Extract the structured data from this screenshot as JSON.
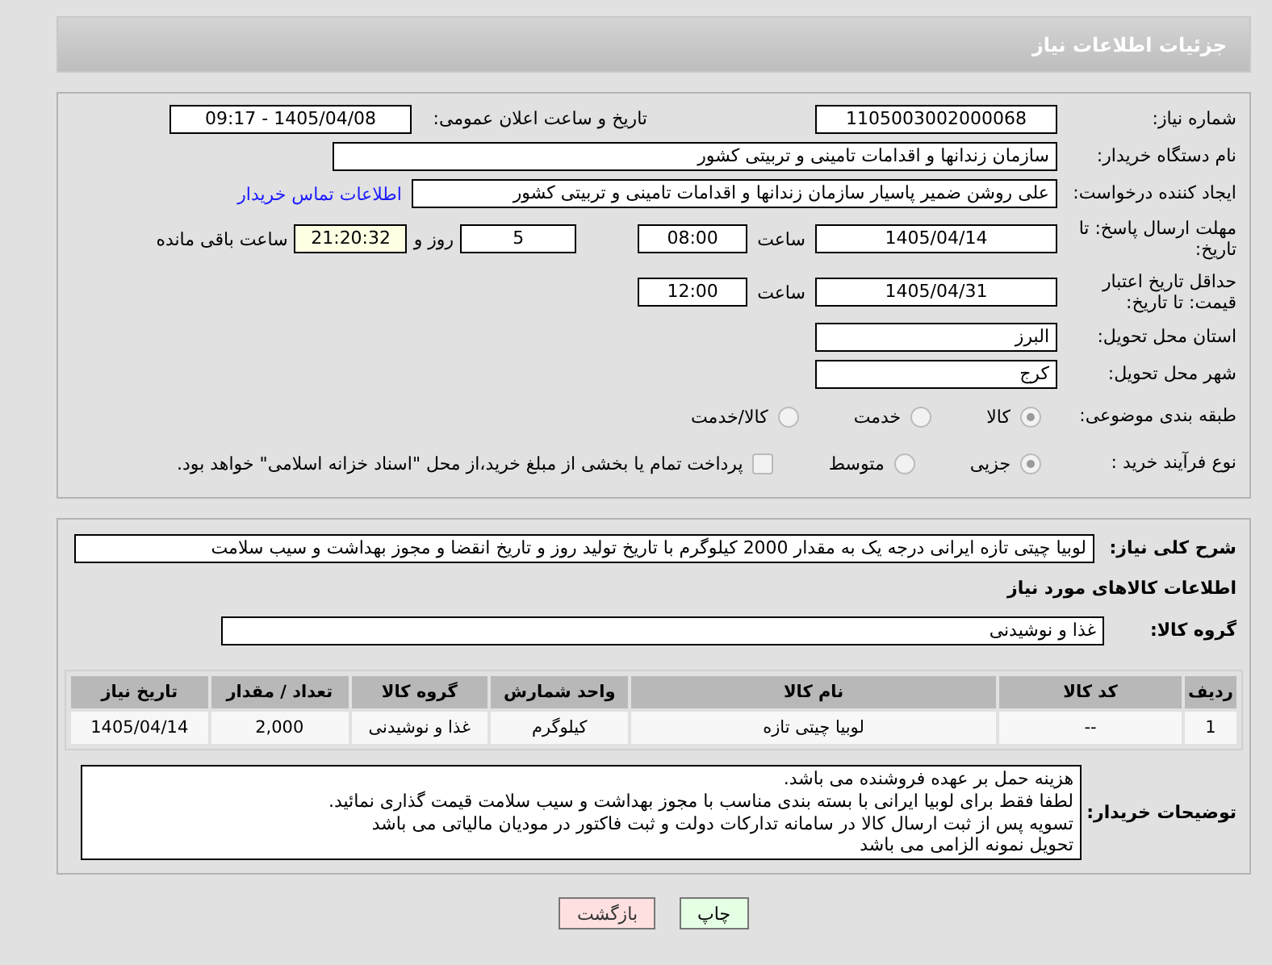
{
  "header": {
    "title": "جزئیات اطلاعات نیاز"
  },
  "need_number": {
    "label": "شماره نیاز:",
    "value": "1105003002000068"
  },
  "announce": {
    "label": "تاریخ و ساعت اعلان عمومی:",
    "value": "1405/04/08 - 09:17"
  },
  "buyer_org": {
    "label": "نام دستگاه خریدار:",
    "value": "سازمان زندانها و اقدامات تامینی و تربیتی کشور"
  },
  "requester": {
    "label": "ایجاد کننده درخواست:",
    "value": "علی روشن ضمیر پاسیار سازمان زندانها و اقدامات تامینی و تربیتی کشور",
    "link": "اطلاعات تماس خریدار"
  },
  "deadline": {
    "label": "مهلت ارسال پاسخ: تا تاریخ:",
    "date": "1405/04/14",
    "time_label": "ساعت",
    "time": "08:00",
    "days": "5",
    "days_label": "روز و",
    "remaining": "21:20:32",
    "remaining_label": "ساعت باقی مانده"
  },
  "validity": {
    "label": "حداقل تاریخ اعتبار قیمت: تا تاریخ:",
    "date": "1405/04/31",
    "time_label": "ساعت",
    "time": "12:00"
  },
  "province": {
    "label": "استان محل تحویل:",
    "value": "البرز"
  },
  "city": {
    "label": "شهر محل تحویل:",
    "value": "کرج"
  },
  "category": {
    "label": "طبقه بندی موضوعی:",
    "options": [
      {
        "label": "کالا",
        "selected": true
      },
      {
        "label": "خدمت",
        "selected": false
      },
      {
        "label": "کالا/خدمت",
        "selected": false
      }
    ]
  },
  "process": {
    "label": "نوع فرآیند خرید :",
    "options": [
      {
        "label": "جزیی",
        "selected": true
      },
      {
        "label": "متوسط",
        "selected": false
      }
    ],
    "payment": {
      "checked": false,
      "text": "پرداخت تمام یا بخشی از مبلغ خرید،از محل \"اسناد خزانه اسلامی\" خواهد بود."
    }
  },
  "description": {
    "label": "شرح کلی نیاز:",
    "text": "لوبیا چیتی تازه ایرانی درجه یک به مقدار 2000 کیلوگرم  با تاریخ تولید روز و تاریخ انقضا و مجوز بهداشت و سیب سلامت"
  },
  "goods_heading": "اطلاعات کالاهای مورد نیاز",
  "goods_group": {
    "label": "گروه کالا:",
    "value": "غذا و نوشیدنی"
  },
  "table": {
    "columns": [
      "ردیف",
      "کد کالا",
      "نام کالا",
      "واحد شمارش",
      "گروه کالا",
      "تعداد / مقدار",
      "تاریخ نیاز"
    ],
    "rows": [
      [
        "1",
        "--",
        "لوبیا چیتی تازه",
        "کیلوگرم",
        "غذا و نوشیدنی",
        "2,000",
        "1405/04/14"
      ]
    ]
  },
  "notes": {
    "label": "توضیحات خریدار:",
    "lines": [
      "هزینه حمل بر عهده فروشنده می باشد.",
      "لطفا فقط برای لوبیا ایرانی با بسته بندی مناسب با مجوز بهداشت و سیب سلامت قیمت گذاری نمائید.",
      "تسویه پس از ثبت ارسال کالا در سامانه تدارکات دولت و ثبت فاکتور در مودیان مالیاتی می باشد",
      "تحویل نمونه الزامی می باشد"
    ]
  },
  "buttons": [
    {
      "label": "چاپ",
      "kind": "print"
    },
    {
      "label": "بازگشت",
      "kind": "back"
    }
  ]
}
